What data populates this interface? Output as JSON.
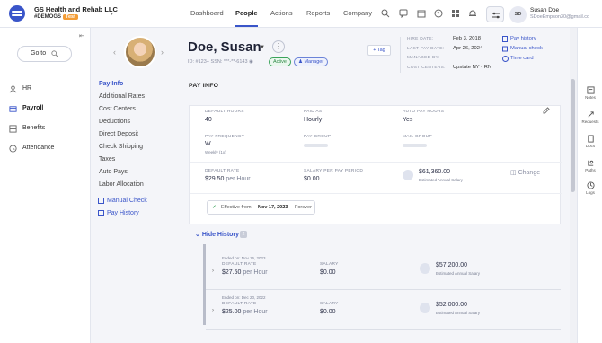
{
  "topbar": {
    "company_name": "GS Health and Rehab LLC",
    "company_code": "#DEMOGS",
    "env_badge": "Test",
    "nav": [
      "Dashboard",
      "People",
      "Actions",
      "Reports",
      "Company"
    ],
    "active_nav": "People",
    "user_initials": "SD",
    "user_name": "Susan Doe",
    "user_email": "SDoeEmpson30@gmail.co",
    "accent_color": "#3a55c9"
  },
  "leftnav": {
    "goto_label": "Go to",
    "items": [
      {
        "label": "HR",
        "icon": "people-icon"
      },
      {
        "label": "Payroll",
        "icon": "payroll-icon"
      },
      {
        "label": "Benefits",
        "icon": "benefits-icon"
      },
      {
        "label": "Attendance",
        "icon": "clock-icon"
      }
    ],
    "active": "Payroll"
  },
  "employee": {
    "name": "Doe, Susan",
    "id_line": "ID: #123+ SSN: ***-**-6143",
    "status_badge": "Active",
    "role_badge": "Manager",
    "tag_button": "+ Tag",
    "hire_date_label": "HIRE DATE:",
    "hire_date": "Feb 3, 2018",
    "last_pay_label": "LAST PAY DATE:",
    "last_pay": "Apr 26, 2024",
    "managed_by_label": "MANAGED BY:",
    "managed_by": "",
    "cost_centers_label": "COST CENTERS:",
    "cost_centers": "Upstate NY - RN",
    "links": [
      "Pay history",
      "Manual check",
      "Time card"
    ]
  },
  "sidemenu": {
    "items": [
      "Pay Info",
      "Additional Rates",
      "Cost Centers",
      "Deductions",
      "Direct Deposit",
      "Check Shipping",
      "Taxes",
      "Auto Pays",
      "Labor Allocation"
    ],
    "active": "Pay Info",
    "links": [
      "Manual Check",
      "Pay History"
    ]
  },
  "payinfo": {
    "section_title": "PAY INFO",
    "default_hours_label": "DEFAULT HOURS",
    "default_hours": "40",
    "paid_as_label": "PAID AS",
    "paid_as": "Hourly",
    "auto_pay_hours_label": "AUTO PAY HOURS",
    "auto_pay_hours": "Yes",
    "pay_frequency_label": "PAY FREQUENCY",
    "pay_frequency": "W",
    "pay_frequency_sub": "Weekly (1x)",
    "pay_group_label": "PAY GROUP",
    "mail_group_label": "MAIL GROUP",
    "default_rate_label": "DEFAULT RATE",
    "default_rate": "$29.50",
    "default_rate_unit": "per Hour",
    "salary_per_period_label": "SALARY PER PAY PERIOD",
    "salary_per_period": "$0.00",
    "annual_salary": "$61,360.00",
    "annual_salary_label": "Estimated Annual Salary",
    "change_label": "Change",
    "effective_prefix": "Effective from:",
    "effective_date": "Nov 17, 2023",
    "effective_suffix": "Forever"
  },
  "history": {
    "toggle_label": "Hide History",
    "count": "2",
    "rows": [
      {
        "ended": "Ended on: Nov 16, 2023",
        "rate_label": "DEFAULT RATE",
        "rate": "$27.50",
        "unit": "per Hour",
        "salary_label": "SALARY",
        "salary": "$0.00",
        "annual": "$57,200.00",
        "annual_label": "Estimated Annual Salary"
      },
      {
        "ended": "Ended on: Dec 20, 2022",
        "rate_label": "DEFAULT RATE",
        "rate": "$25.00",
        "unit": "per Hour",
        "salary_label": "SALARY",
        "salary": "$0.00",
        "annual": "$52,000.00",
        "annual_label": "Estimated Annual Salary"
      }
    ]
  },
  "rightrail": [
    "Notes",
    "Requests",
    "Docs",
    "Paths",
    "Logs"
  ]
}
